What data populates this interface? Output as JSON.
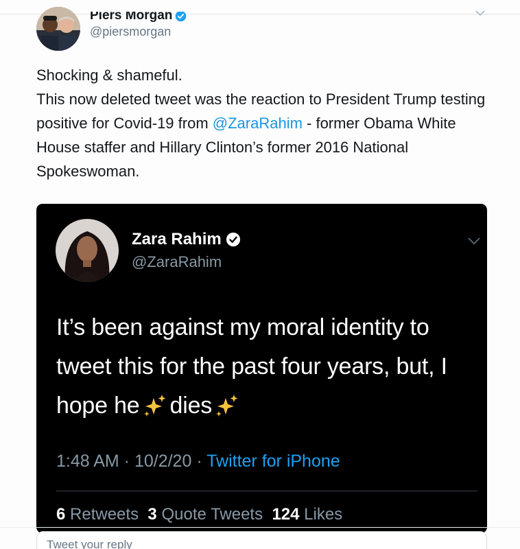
{
  "outer_tweet": {
    "author_name": "Piers Morgan",
    "author_handle": "@piersmorgan",
    "body_lines": {
      "line1": "Shocking & shameful.",
      "line2_before": "This now deleted tweet was the reaction to President Trump testing positive for Covid-19 from ",
      "mention": "@ZaraRahim",
      "line2_after": " - former Obama White House staffer and Hillary Clinton’s former 2016 National Spokeswoman."
    }
  },
  "embedded_tweet": {
    "author_name": "Zara Rahim",
    "author_handle": "@ZaraRahim",
    "text_part1": "It’s been against my moral identity to tweet this for the past four years, but, I hope he",
    "text_part2": "dies",
    "time": "1:48 AM",
    "date": "10/2/20",
    "separator": " · ",
    "source": "Twitter for iPhone",
    "stats": {
      "retweets_count": "6",
      "retweets_label": "Retweets",
      "quotes_count": "3",
      "quotes_label": "Quote Tweets",
      "likes_count": "124",
      "likes_label": "Likes"
    }
  },
  "reply": {
    "placeholder": "Tweet your reply"
  },
  "colors": {
    "accent": "#1da1f2",
    "mention": "#1b95e0",
    "embed_background": "#000000"
  },
  "icons": [
    "avatar",
    "verified-badge-icon",
    "chevron-down-icon",
    "sparkles-icon"
  ]
}
